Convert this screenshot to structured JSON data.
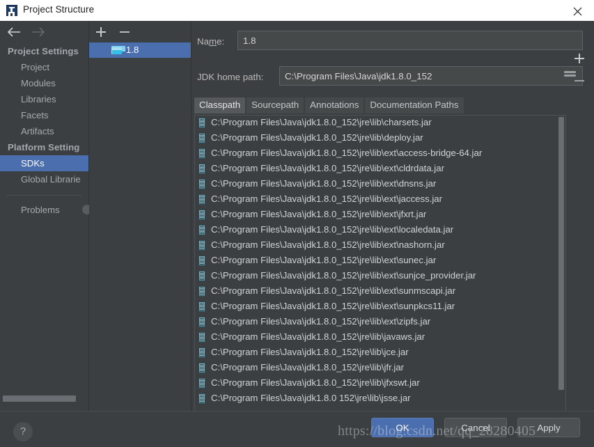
{
  "window": {
    "title": "Project Structure",
    "app_icon": "intellij-idea-icon",
    "close_label": "×"
  },
  "nav": {
    "back_icon": "arrow-left-icon",
    "forward_icon": "arrow-right-icon",
    "groups": [
      {
        "label": "Project Settings",
        "items": [
          {
            "label": "Project",
            "selected": false
          },
          {
            "label": "Modules",
            "selected": false
          },
          {
            "label": "Libraries",
            "selected": false
          },
          {
            "label": "Facets",
            "selected": false
          },
          {
            "label": "Artifacts",
            "selected": false
          }
        ]
      },
      {
        "label": "Platform Setting",
        "items": [
          {
            "label": "SDKs",
            "selected": true
          },
          {
            "label": "Global Librarie",
            "selected": false
          }
        ]
      }
    ],
    "problems_label": "Problems"
  },
  "sdk_pane": {
    "add_label": "+",
    "remove_label": "−",
    "items": [
      {
        "label": "1.8",
        "icon": "folder-icon",
        "selected": true
      }
    ]
  },
  "detail": {
    "name_label": "Name:",
    "name_value": "1.8",
    "home_label": "JDK home path:",
    "home_value": "C:\\Program Files\\Java\\jdk1.8.0_152",
    "browse_icon": "folder-browse-icon",
    "tabs": [
      {
        "label": "Classpath",
        "active": true
      },
      {
        "label": "Sourcepath",
        "active": false
      },
      {
        "label": "Annotations",
        "active": false
      },
      {
        "label": "Documentation Paths",
        "active": false
      }
    ],
    "list_add_label": "+",
    "list_remove_label": "−",
    "classpath_entries": [
      "C:\\Program Files\\Java\\jdk1.8.0_152\\jre\\lib\\charsets.jar",
      "C:\\Program Files\\Java\\jdk1.8.0_152\\jre\\lib\\deploy.jar",
      "C:\\Program Files\\Java\\jdk1.8.0_152\\jre\\lib\\ext\\access-bridge-64.jar",
      "C:\\Program Files\\Java\\jdk1.8.0_152\\jre\\lib\\ext\\cldrdata.jar",
      "C:\\Program Files\\Java\\jdk1.8.0_152\\jre\\lib\\ext\\dnsns.jar",
      "C:\\Program Files\\Java\\jdk1.8.0_152\\jre\\lib\\ext\\jaccess.jar",
      "C:\\Program Files\\Java\\jdk1.8.0_152\\jre\\lib\\ext\\jfxrt.jar",
      "C:\\Program Files\\Java\\jdk1.8.0_152\\jre\\lib\\ext\\localedata.jar",
      "C:\\Program Files\\Java\\jdk1.8.0_152\\jre\\lib\\ext\\nashorn.jar",
      "C:\\Program Files\\Java\\jdk1.8.0_152\\jre\\lib\\ext\\sunec.jar",
      "C:\\Program Files\\Java\\jdk1.8.0_152\\jre\\lib\\ext\\sunjce_provider.jar",
      "C:\\Program Files\\Java\\jdk1.8.0_152\\jre\\lib\\ext\\sunmscapi.jar",
      "C:\\Program Files\\Java\\jdk1.8.0_152\\jre\\lib\\ext\\sunpkcs11.jar",
      "C:\\Program Files\\Java\\jdk1.8.0_152\\jre\\lib\\ext\\zipfs.jar",
      "C:\\Program Files\\Java\\jdk1.8.0_152\\jre\\lib\\javaws.jar",
      "C:\\Program Files\\Java\\jdk1.8.0_152\\jre\\lib\\jce.jar",
      "C:\\Program Files\\Java\\jdk1.8.0_152\\jre\\lib\\jfr.jar",
      "C:\\Program Files\\Java\\jdk1.8.0_152\\jre\\lib\\jfxswt.jar",
      "C:\\Program Files\\Java\\jdk1.8.0 152\\jre\\lib\\jsse.jar"
    ]
  },
  "footer": {
    "help_label": "?",
    "ok_label": "OK",
    "cancel_label": "Cancel",
    "apply_label": "Apply"
  },
  "watermark": {
    "text": "https://blog.csdn.net/qq_28280405"
  },
  "colors": {
    "accent": "#4b6eaf",
    "panel_bg": "#3c3f41",
    "field_bg": "#45494a",
    "text": "#d0d4d7",
    "titlebar_bg": "#ffffff"
  }
}
